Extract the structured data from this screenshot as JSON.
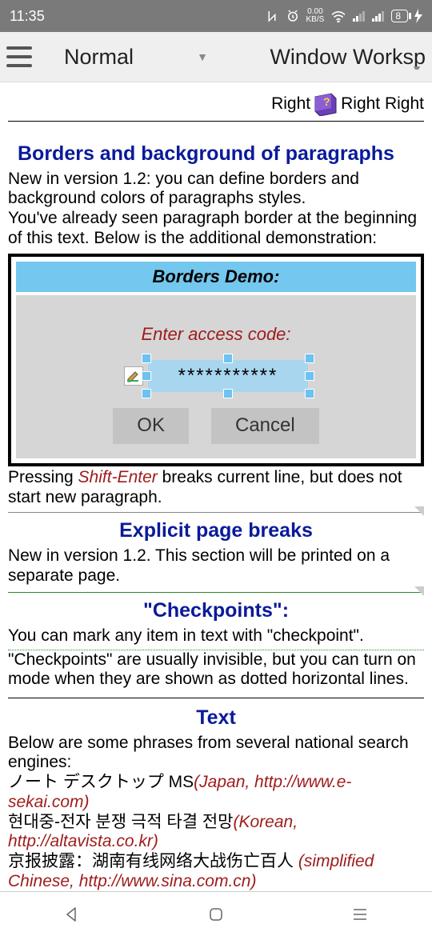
{
  "statusbar": {
    "time": "11:35",
    "net_speed_top": "0.00",
    "net_speed_unit": "KB/S",
    "battery": "8"
  },
  "toolbar": {
    "style_selected": "Normal",
    "window_label": "Window Worksp"
  },
  "top_line": {
    "right1": "Right",
    "right2": "Right Right"
  },
  "sections": {
    "borders_title": "Borders and background of paragraphs",
    "borders_p1": "New in version 1.2: you can define borders and background colors of paragraphs styles.",
    "borders_p2": "You've already seen paragraph border at the beginning of this text. Below is the additional demonstration:",
    "demo_header": "Borders Demo:",
    "demo_prompt": "Enter access code:",
    "demo_password": "***********",
    "demo_ok": "OK",
    "demo_cancel": "Cancel",
    "shift_enter_pre": "Pressing ",
    "shift_enter_key": "Shift-Enter",
    "shift_enter_post": " breaks current line, but does not start new paragraph.",
    "pagebreaks_title": "Explicit page breaks",
    "pagebreaks_p": "New in version 1.2. This section will be printed on a separate page.",
    "checkpoints_title": "\"Checkpoints\":",
    "checkpoints_p1": "You can mark any item in text with \"checkpoint\".",
    "checkpoints_p2": "\"Checkpoints\" are usually invisible, but you can turn on mode when they are shown as dotted horizontal lines.",
    "text_title": "Text",
    "text_intro": "Below are some phrases from several national search engines:",
    "jp_text": "ノート デスクトップ MS",
    "jp_src": "(Japan, http://www.e-sekai.com)",
    "kr_text": " 현대중-전자 분쟁 극적 타결 전망",
    "kr_src": "(Korean, http://altavista.co.kr)",
    "cn_text": "京报披露：湖南有线网络大战伤亡百人 ",
    "cn_src": "(simplified Chinese, http://www.sina.com.cn)"
  }
}
